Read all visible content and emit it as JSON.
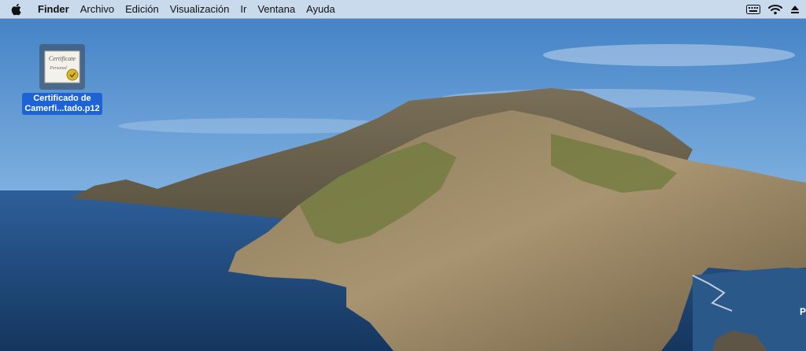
{
  "menubar": {
    "apple_icon": "apple-logo-icon",
    "app_name": "Finder",
    "items": [
      "Archivo",
      "Edición",
      "Visualización",
      "Ir",
      "Ventana",
      "Ayuda"
    ],
    "status_icons": [
      "keyboard-input-icon",
      "wifi-icon",
      "eject-icon"
    ]
  },
  "desktop": {
    "file": {
      "label": "Certificado de\nCamerfi...tado.p12",
      "icon": "certificate-file-icon",
      "thumb_text": "Certificate",
      "thumb_subtext": "Personal"
    },
    "edge_char": "P"
  },
  "colors": {
    "selection": "#1d63d6",
    "menubar": "#d6e2f0"
  }
}
